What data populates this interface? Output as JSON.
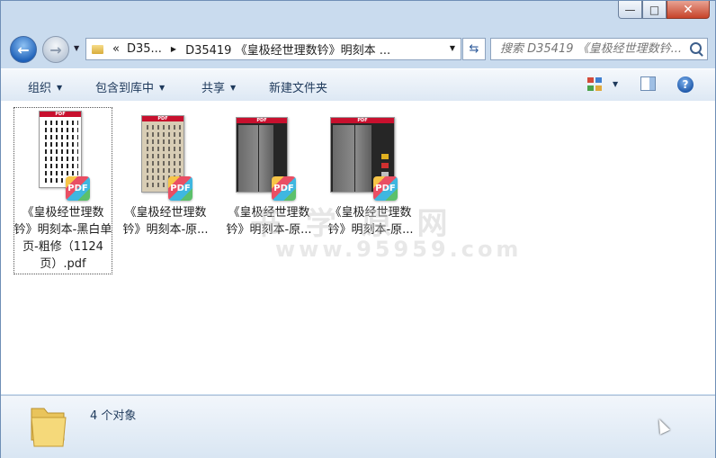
{
  "window": {
    "minimize_icon": "minimize-icon",
    "maximize_icon": "maximize-icon",
    "close_icon": "close-icon"
  },
  "nav": {
    "breadcrumb_prefix": "«",
    "breadcrumb_1": "D35...",
    "breadcrumb_2": "D35419 《皇极经世理数钤》明刻本 ...",
    "search_placeholder": "搜索 D35419 《皇极经世理数钤..."
  },
  "toolbar": {
    "organize": "组织",
    "include_in_library": "包含到库中",
    "share": "共享",
    "new_folder": "新建文件夹"
  },
  "files": [
    {
      "name": "《皇极经世理数钤》明刻本-黑白单页-粗修（1124页）.pdf",
      "badge": "PDF",
      "band": "PDF"
    },
    {
      "name": "《皇极经世理数钤》明刻本-原...",
      "badge": "PDF",
      "band": "PDF"
    },
    {
      "name": "《皇极经世理数钤》明刻本-原...",
      "badge": "PDF",
      "band": "PDF"
    },
    {
      "name": "《皇极经世理数钤》明刻本-原...",
      "badge": "PDF",
      "band": "PDF"
    }
  ],
  "status": {
    "count_text": "4 个对象"
  },
  "watermark": {
    "line1": "书 学 原 网",
    "line2": "www.95959.com"
  },
  "colors": {
    "frame": "#c9dbee",
    "pdf_band": "#c8102e",
    "accent_text": "#1e395b"
  }
}
